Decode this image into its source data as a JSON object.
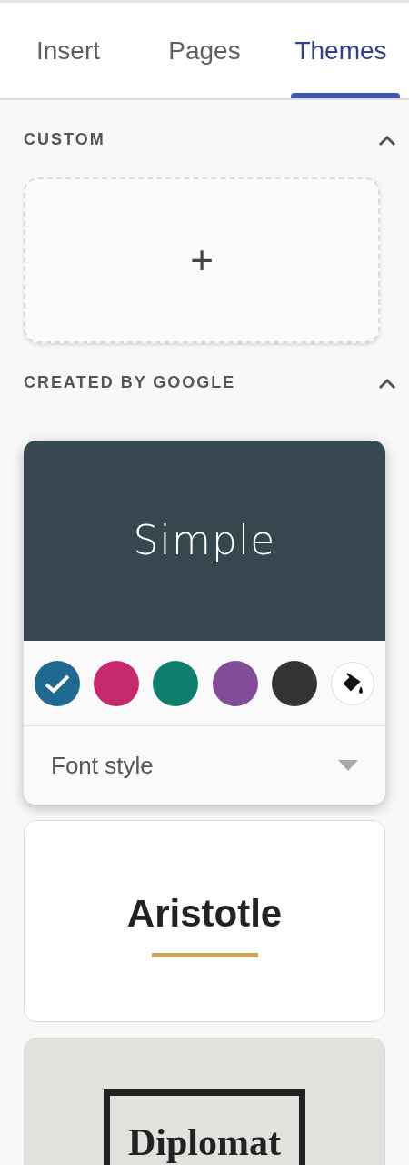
{
  "tabs": [
    {
      "label": "Insert",
      "selected": false
    },
    {
      "label": "Pages",
      "selected": false
    },
    {
      "label": "Themes",
      "selected": true
    }
  ],
  "custom": {
    "title": "CUSTOM",
    "expanded": true,
    "add_label": "+"
  },
  "google": {
    "title": "CREATED BY GOOGLE",
    "expanded": true,
    "themes": [
      {
        "kind": "simple",
        "name": "Simple",
        "expanded": true,
        "colors": [
          {
            "color": "#1f6a91",
            "selected": true
          },
          {
            "color": "#c52a6e",
            "selected": false
          },
          {
            "color": "#0e7f6e",
            "selected": false
          },
          {
            "color": "#824d98",
            "selected": false
          },
          {
            "color": "#333333",
            "selected": false
          }
        ],
        "font_style": "Font style"
      },
      {
        "kind": "aristotle",
        "name": "Aristotle",
        "expanded": false
      },
      {
        "kind": "diplomat",
        "name": "Diplomat",
        "expanded": false
      }
    ]
  }
}
